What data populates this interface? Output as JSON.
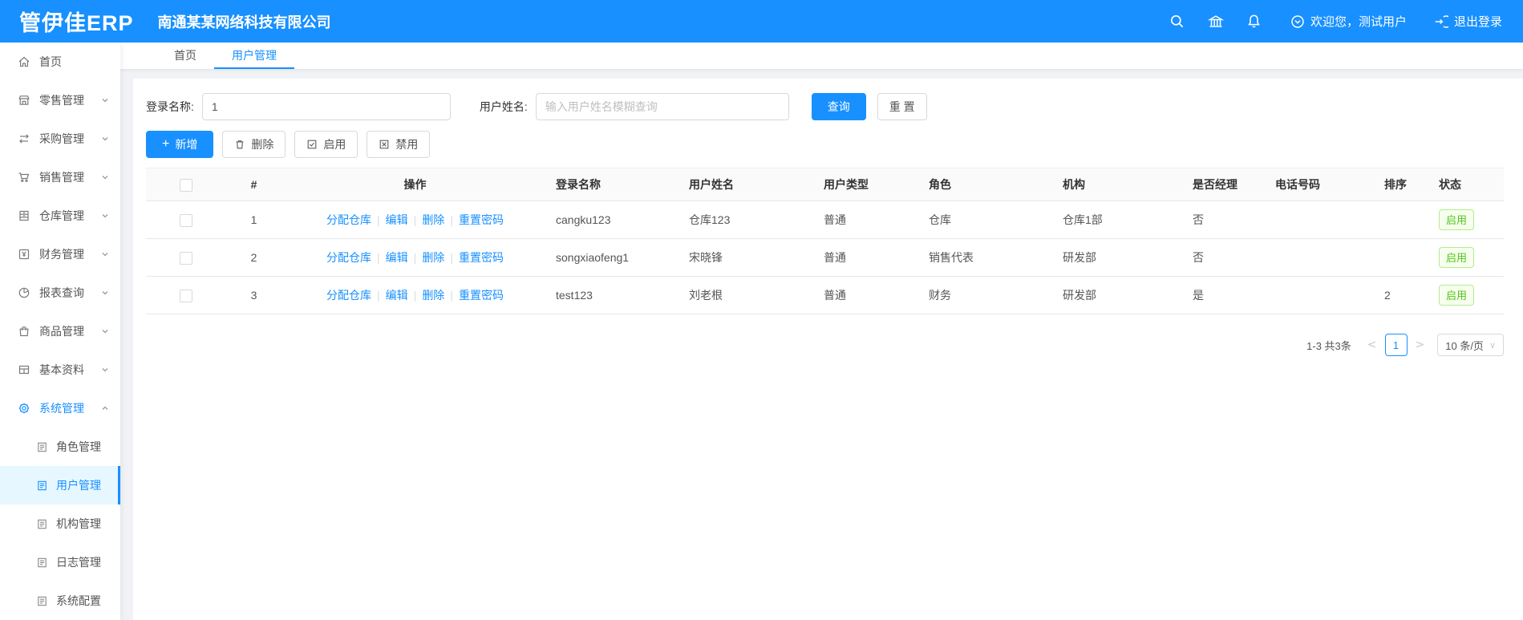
{
  "topbar": {
    "logo": "管伊佳ERP",
    "company": "南通某某网络科技有限公司",
    "welcome": "欢迎您，测试用户",
    "logout": "退出登录"
  },
  "tabs": {
    "home": "首页",
    "user_mgmt": "用户管理"
  },
  "sidebar": {
    "items": [
      {
        "label": "首页"
      },
      {
        "label": "零售管理"
      },
      {
        "label": "采购管理"
      },
      {
        "label": "销售管理"
      },
      {
        "label": "仓库管理"
      },
      {
        "label": "财务管理"
      },
      {
        "label": "报表查询"
      },
      {
        "label": "商品管理"
      },
      {
        "label": "基本资料"
      },
      {
        "label": "系统管理"
      }
    ],
    "subitems": [
      {
        "label": "角色管理"
      },
      {
        "label": "用户管理"
      },
      {
        "label": "机构管理"
      },
      {
        "label": "日志管理"
      },
      {
        "label": "系统配置"
      }
    ]
  },
  "filters": {
    "login_name_label": "登录名称:",
    "login_name_value": "1",
    "user_name_label": "用户姓名:",
    "user_name_placeholder": "输入用户姓名模糊查询",
    "search_label": "查询",
    "reset_label": "重 置"
  },
  "toolbar": {
    "add_label": "新增",
    "delete_label": "删除",
    "enable_label": "启用",
    "disable_label": "禁用"
  },
  "table": {
    "headers": {
      "index": "#",
      "actions": "操作",
      "login": "登录名称",
      "name": "用户姓名",
      "type": "用户类型",
      "role": "角色",
      "org": "机构",
      "manager": "是否经理",
      "phone": "电话号码",
      "sort": "排序",
      "status": "状态"
    },
    "action_links": [
      "分配仓库",
      "编辑",
      "删除",
      "重置密码"
    ],
    "link_separator": "|",
    "rows": [
      {
        "index": "1",
        "login": "cangku123",
        "name": "仓库123",
        "type": "普通",
        "role": "仓库",
        "org": "仓库1部",
        "manager": "否",
        "phone": "",
        "sort": "",
        "status": "启用"
      },
      {
        "index": "2",
        "login": "songxiaofeng1",
        "name": "宋晓锋",
        "type": "普通",
        "role": "销售代表",
        "org": "研发部",
        "manager": "否",
        "phone": "",
        "sort": "",
        "status": "启用"
      },
      {
        "index": "3",
        "login": "test123",
        "name": "刘老根",
        "type": "普通",
        "role": "财务",
        "org": "研发部",
        "manager": "是",
        "phone": "",
        "sort": "2",
        "status": "启用"
      }
    ]
  },
  "pagination": {
    "total": "1-3 共3条",
    "prev": "<",
    "current": "1",
    "next": ">",
    "page_size": "10 条/页",
    "caret": "∨"
  },
  "colors": {
    "primary": "#1890ff",
    "status_green": "#52c41a",
    "topbar": "#1890ff"
  }
}
